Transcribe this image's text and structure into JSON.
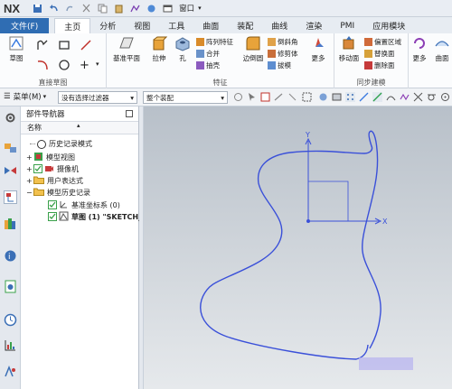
{
  "app": {
    "logo": "NX"
  },
  "quick_access": {
    "window_label": "窗口"
  },
  "tabs": [
    {
      "label": "文件(F)"
    },
    {
      "label": "主页"
    },
    {
      "label": "分析"
    },
    {
      "label": "视图"
    },
    {
      "label": "工具"
    },
    {
      "label": "曲面"
    },
    {
      "label": "装配"
    },
    {
      "label": "曲线"
    },
    {
      "label": "渲染"
    },
    {
      "label": "PMI"
    },
    {
      "label": "应用模块"
    }
  ],
  "ribbon": {
    "direct_sketch": {
      "group_label": "直接草图",
      "sketch_label": "草图"
    },
    "feature": {
      "group_label": "特征",
      "datum_plane": "基准平面",
      "extrude": "拉伸",
      "hole": "孔",
      "pattern_feature": "阵列特征",
      "unite": "合并",
      "shell": "抽壳",
      "edge_blend": "边倒圆",
      "chamfer": "倒斜角",
      "trim_body": "修剪体",
      "draft": "拔模",
      "more": "更多"
    },
    "sync": {
      "group_label": "同步建模",
      "move_face": "移动面",
      "offset_region": "偏置区域",
      "replace_face": "替换面",
      "delete_face": "删除面",
      "more": "更多"
    },
    "extra": {
      "more": "更多",
      "surface": "曲面"
    }
  },
  "toolbar": {
    "menu_label": "菜单(M)",
    "filter_value": "没有选择过滤器",
    "scope_value": "整个装配"
  },
  "navigator": {
    "title": "部件导航器",
    "column_header": "名称",
    "items": [
      {
        "label": "历史记录模式"
      },
      {
        "label": "模型视图"
      },
      {
        "label": "摄像机"
      },
      {
        "label": "用户表达式"
      },
      {
        "label": "模型历史记录"
      },
      {
        "label": "基准坐标系 (0)"
      },
      {
        "label": "草图 (1) \"SKETCH_..."
      }
    ]
  },
  "viewport": {
    "axis_y": "Y",
    "axis_x": "X"
  },
  "colors": {
    "file_tab": "#2f6db3",
    "curve": "#3a50d9",
    "axis": "#3a50d9"
  }
}
